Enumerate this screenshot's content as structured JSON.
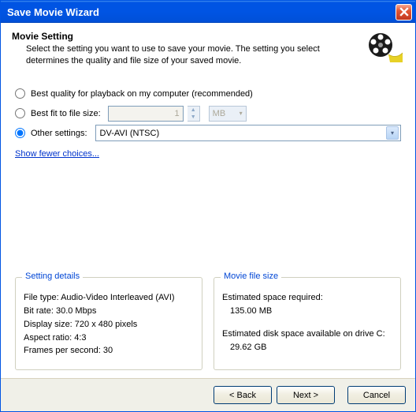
{
  "window": {
    "title": "Save Movie Wizard"
  },
  "header": {
    "heading": "Movie Setting",
    "desc": "Select the setting you want to use to save your movie. The setting you select determines the quality and file size of your saved movie."
  },
  "options": {
    "best_quality": "Best quality for playback on my computer (recommended)",
    "best_fit": "Best fit to file size:",
    "best_fit_value": "1",
    "best_fit_unit": "MB",
    "other": "Other settings:",
    "other_value": "DV-AVI (NTSC)",
    "fewer": "Show fewer choices..."
  },
  "details": {
    "legend": "Setting details",
    "filetype": "File type: Audio-Video Interleaved (AVI)",
    "bitrate": "Bit rate: 30.0 Mbps",
    "display": "Display size: 720 x 480 pixels",
    "aspect": "Aspect ratio: 4:3",
    "fps": "Frames per second: 30"
  },
  "filesize": {
    "legend": "Movie file size",
    "req_label": "Estimated space required:",
    "req_value": "135.00 MB",
    "avail_label": "Estimated disk space available on drive C:",
    "avail_value": "29.62 GB"
  },
  "buttons": {
    "back": "< Back",
    "next": "Next >",
    "cancel": "Cancel"
  }
}
